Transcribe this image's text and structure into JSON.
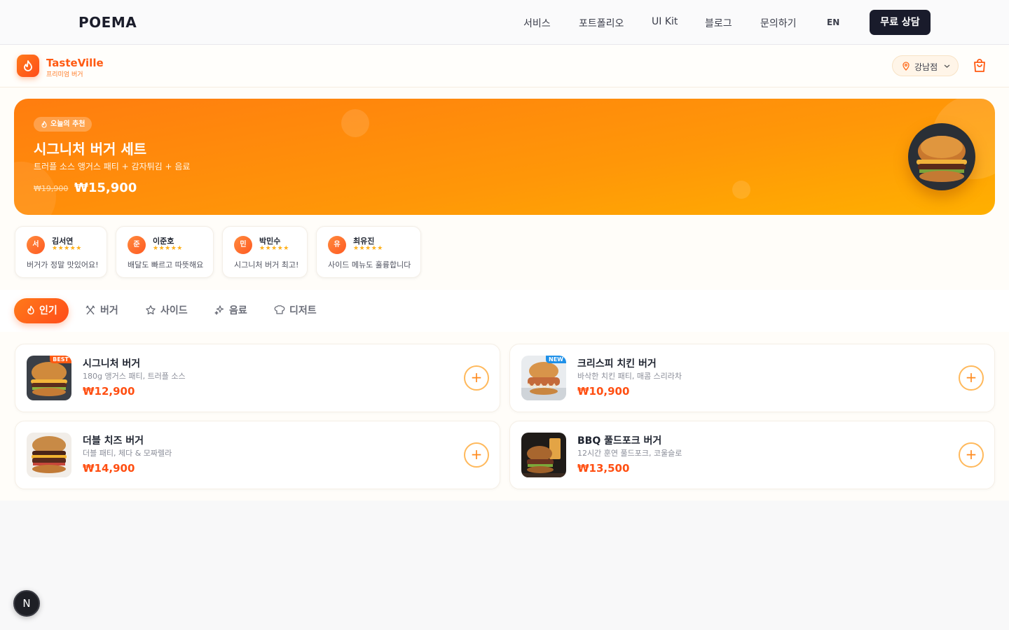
{
  "topnav": {
    "brand": "POEMA",
    "links": [
      "서비스",
      "포트폴리오",
      "UI Kit",
      "블로그",
      "문의하기",
      "EN"
    ],
    "cta": "무료 상담"
  },
  "app": {
    "name": "TasteVille",
    "subtitle": "프리미엄 버거",
    "branch": "강남점"
  },
  "hero": {
    "badge": "오늘의 추천",
    "title": "시그니처 버거 세트",
    "desc": "트러플 소스 앵거스 패티 + 감자튀김 + 음료",
    "old_price": "₩19,900",
    "price": "₩15,900"
  },
  "reviews": [
    {
      "initial": "서",
      "name": "김서연",
      "stars": "★★★★★",
      "text": "버거가 정말 맛있어요!"
    },
    {
      "initial": "준",
      "name": "이준호",
      "stars": "★★★★★",
      "text": "배달도 빠르고 따뜻해요"
    },
    {
      "initial": "민",
      "name": "박민수",
      "stars": "★★★★★",
      "text": "시그니처 버거 최고!"
    },
    {
      "initial": "유",
      "name": "최유진",
      "stars": "★★★★★",
      "text": "사이드 메뉴도 훌륭합니다"
    }
  ],
  "tabs": [
    "인기",
    "버거",
    "사이드",
    "음료",
    "디저트"
  ],
  "menu": [
    {
      "name": "시그니처 버거",
      "desc": "180g 앵거스 패티, 트러플 소스",
      "price": "₩12,900",
      "tag": "BEST"
    },
    {
      "name": "크리스피 치킨 버거",
      "desc": "바삭한 치킨 패티, 매콤 스리라차",
      "price": "₩10,900",
      "tag": "NEW"
    },
    {
      "name": "더블 치즈 버거",
      "desc": "더블 패티, 체다 & 모짜렐라",
      "price": "₩14,900",
      "tag": ""
    },
    {
      "name": "BBQ 풀드포크 버거",
      "desc": "12시간 훈연 풀드포크, 코울슬로",
      "price": "₩13,500",
      "tag": ""
    }
  ],
  "colors": {
    "accent": "#ff5a12",
    "hero": "#ff8c0a",
    "dark": "#191b2b"
  },
  "fab": "N"
}
